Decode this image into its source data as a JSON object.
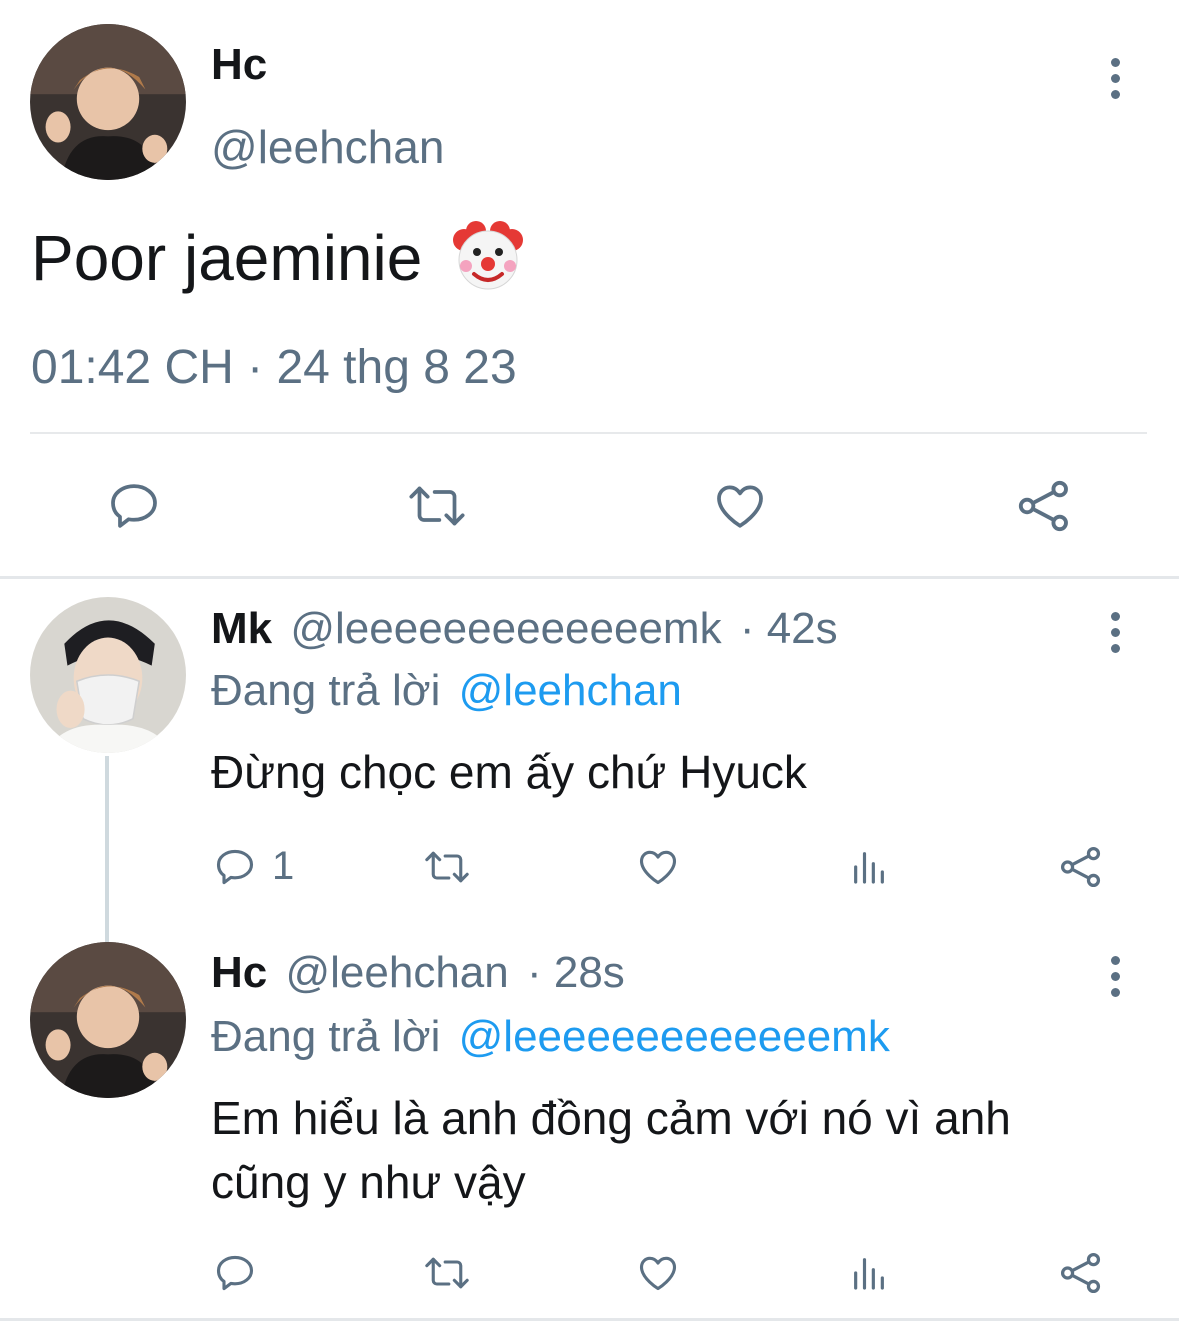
{
  "main_tweet": {
    "display_name": "Hc",
    "handle": "@leehchan",
    "text": "Poor jaeminie",
    "emoji": "🤡",
    "timestamp": "01:42 CH · 24 thg 8 23"
  },
  "replies": [
    {
      "display_name": "Mk",
      "handle": "@leeeeeeeeeeeeemk",
      "time": "· 42s",
      "replying_prefix": "Đang trả lời",
      "replying_to": "@leehchan",
      "text": "Đừng chọc em ấy chứ Hyuck",
      "reply_count": "1"
    },
    {
      "display_name": "Hc",
      "handle": "@leehchan",
      "time": "· 28s",
      "replying_prefix": "Đang trả lời",
      "replying_to": "@leeeeeeeeeeeeemk",
      "text_line1": "Em hiểu là anh đồng cảm với nó vì anh",
      "text_line2": "cũng y như vậy",
      "reply_count": ""
    }
  ],
  "icons": {
    "reply": "reply-bubble-icon",
    "retweet": "retweet-icon",
    "like": "heart-icon",
    "views": "analytics-icon",
    "share": "share-icon",
    "more": "more-vertical-icon"
  },
  "colors": {
    "text": "#141619",
    "secondary": "#5b7083",
    "link": "#1d9bf0",
    "divider": "#e7e9eb"
  }
}
